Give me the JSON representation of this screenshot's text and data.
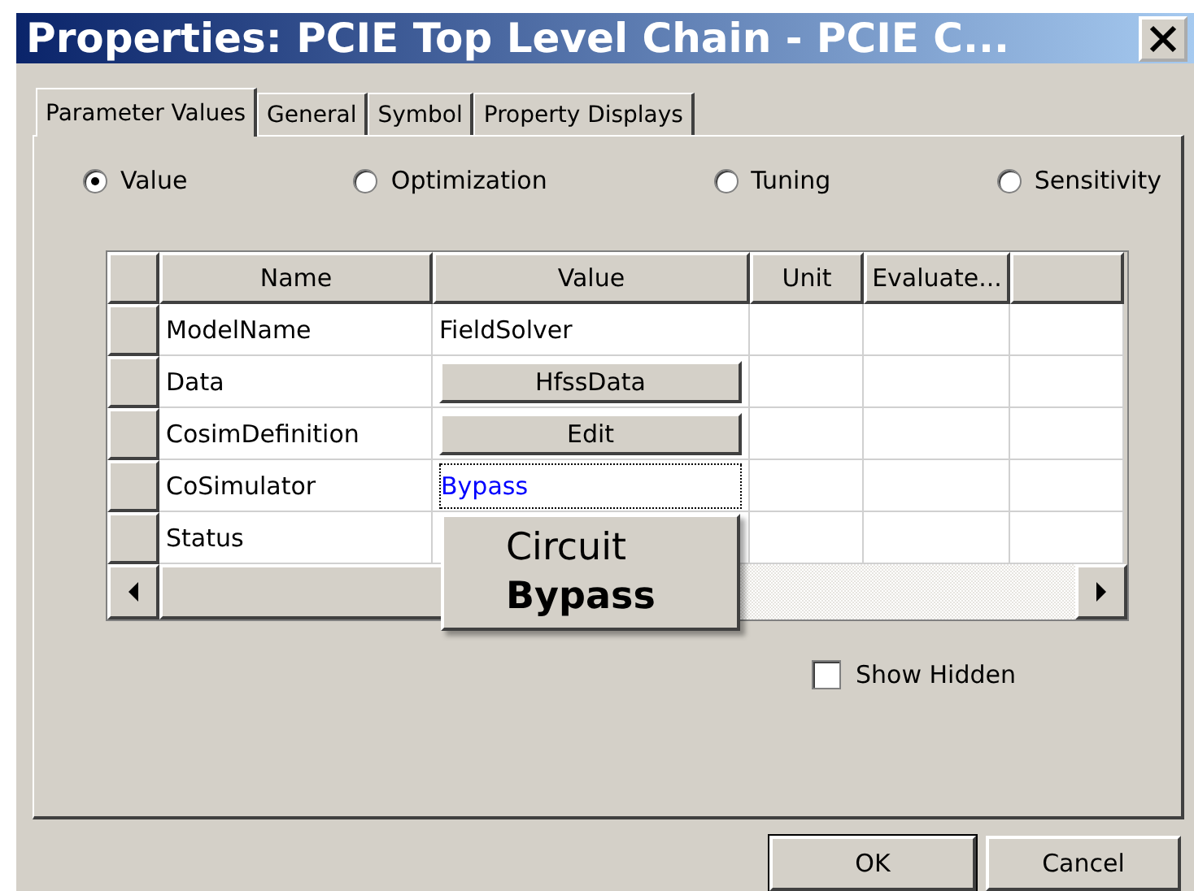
{
  "window": {
    "title": "Properties: PCIE Top Level Chain - PCIE C..."
  },
  "tabs": [
    {
      "label": "Parameter Values",
      "selected": true
    },
    {
      "label": "General",
      "selected": false
    },
    {
      "label": "Symbol",
      "selected": false
    },
    {
      "label": "Property Displays",
      "selected": false
    }
  ],
  "modes": [
    {
      "label": "Value",
      "selected": true
    },
    {
      "label": "Optimization",
      "selected": false
    },
    {
      "label": "Tuning",
      "selected": false
    },
    {
      "label": "Sensitivity",
      "selected": false
    }
  ],
  "table": {
    "columns": [
      "Name",
      "Value",
      "Unit",
      "Evaluate..."
    ],
    "rows": [
      {
        "name": "ModelName",
        "value": {
          "kind": "text",
          "text": "FieldSolver"
        }
      },
      {
        "name": "Data",
        "value": {
          "kind": "button",
          "text": "HfssData"
        }
      },
      {
        "name": "CosimDefinition",
        "value": {
          "kind": "button",
          "text": "Edit"
        }
      },
      {
        "name": "CoSimulator",
        "value": {
          "kind": "choice",
          "text": "Bypass"
        }
      },
      {
        "name": "Status"
      }
    ]
  },
  "dropdown": {
    "options": [
      {
        "label": "Circuit",
        "selected": false
      },
      {
        "label": "Bypass",
        "selected": true
      }
    ]
  },
  "show_hidden": {
    "label": "Show Hidden",
    "checked": false
  },
  "buttons": [
    {
      "label": "OK",
      "default": true
    },
    {
      "label": "Cancel",
      "default": false
    }
  ]
}
